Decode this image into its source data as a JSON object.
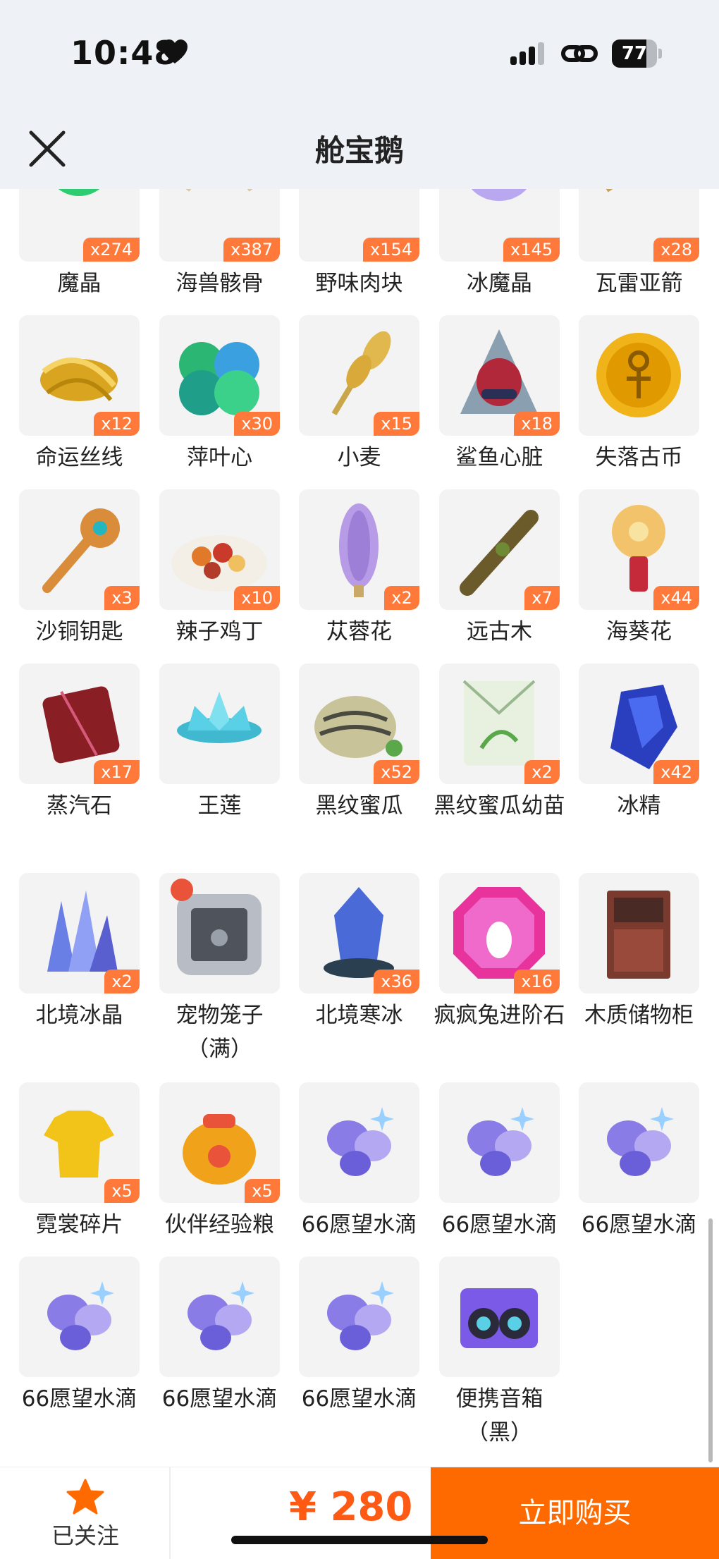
{
  "status_bar": {
    "time": "10:48",
    "battery": "77",
    "battery_fraction": 0.77
  },
  "nav": {
    "title": "舱宝鹅"
  },
  "items": [
    {
      "name": "魔晶",
      "qty": "x274",
      "icon": "magic-crystal-icon"
    },
    {
      "name": "海兽骸骨",
      "qty": "x387",
      "icon": "sea-beast-bone-icon"
    },
    {
      "name": "野味肉块",
      "qty": "x154",
      "icon": "meat-chunk-icon"
    },
    {
      "name": "冰魔晶",
      "qty": "x145",
      "icon": "ice-crystal-icon"
    },
    {
      "name": "瓦雷亚箭",
      "qty": "x28",
      "icon": "arrow-icon"
    },
    {
      "name": "命运丝线",
      "qty": "x12",
      "icon": "golden-thread-icon"
    },
    {
      "name": "萍叶心",
      "qty": "x30",
      "icon": "clover-leaf-icon"
    },
    {
      "name": "小麦",
      "qty": "x15",
      "icon": "wheat-icon"
    },
    {
      "name": "鲨鱼心脏",
      "qty": "x18",
      "icon": "shark-heart-icon"
    },
    {
      "name": "失落古币",
      "qty": "",
      "icon": "ancient-coin-icon"
    },
    {
      "name": "沙铜钥匙",
      "qty": "x3",
      "icon": "bronze-key-icon"
    },
    {
      "name": "辣子鸡丁",
      "qty": "x10",
      "icon": "spicy-chicken-dish-icon"
    },
    {
      "name": "苁蓉花",
      "qty": "x2",
      "icon": "purple-flower-icon"
    },
    {
      "name": "远古木",
      "qty": "x7",
      "icon": "ancient-wood-icon"
    },
    {
      "name": "海葵花",
      "qty": "x44",
      "icon": "anemone-flower-icon"
    },
    {
      "name": "蒸汽石",
      "qty": "x17",
      "icon": "steam-stone-icon"
    },
    {
      "name": "王莲",
      "qty": "",
      "icon": "lotus-icon"
    },
    {
      "name": "黑纹蜜瓜",
      "qty": "x52",
      "icon": "melon-icon"
    },
    {
      "name": "黑纹蜜瓜幼苗",
      "qty": "x2",
      "icon": "seed-packet-icon"
    },
    {
      "name": "冰精",
      "qty": "x42",
      "icon": "ice-essence-icon"
    },
    {
      "name": "北境冰晶",
      "qty": "x2",
      "icon": "north-ice-crystal-icon"
    },
    {
      "name": "宠物笼子（满）",
      "qty": "",
      "icon": "pet-cage-icon"
    },
    {
      "name": "北境寒冰",
      "qty": "x36",
      "icon": "north-cold-ice-icon"
    },
    {
      "name": "疯疯兔进阶石",
      "qty": "x16",
      "icon": "rabbit-upgrade-gem-icon"
    },
    {
      "name": "木质储物柜",
      "qty": "",
      "icon": "wooden-cabinet-icon"
    },
    {
      "name": "霓裳碎片",
      "qty": "x5",
      "icon": "shirt-fragment-icon"
    },
    {
      "name": "伙伴经验粮",
      "qty": "x5",
      "icon": "exp-food-bag-icon"
    },
    {
      "name": "66愿望水滴",
      "qty": "",
      "icon": "wish-drop-icon"
    },
    {
      "name": "66愿望水滴",
      "qty": "",
      "icon": "wish-drop-icon"
    },
    {
      "name": "66愿望水滴",
      "qty": "",
      "icon": "wish-drop-icon"
    },
    {
      "name": "66愿望水滴",
      "qty": "",
      "icon": "wish-drop-icon"
    },
    {
      "name": "66愿望水滴",
      "qty": "",
      "icon": "wish-drop-icon"
    },
    {
      "name": "66愿望水滴",
      "qty": "",
      "icon": "wish-drop-icon"
    },
    {
      "name": "便携音箱（黑）",
      "qty": "",
      "icon": "portable-speaker-icon"
    }
  ],
  "bottom_bar": {
    "follow_label": "已关注",
    "price": "¥ 280",
    "buy_label": "立即购买"
  },
  "colors": {
    "accent": "#ff6a00",
    "badge": "#ff7a3a",
    "price": "#ff5a14"
  }
}
